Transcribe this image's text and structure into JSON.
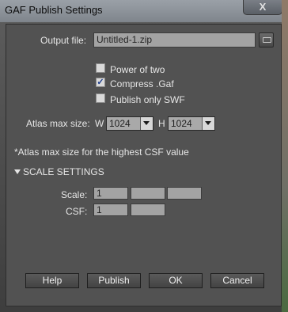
{
  "window": {
    "title": "GAF Publish Settings",
    "close_symbol": "X"
  },
  "output": {
    "label": "Output file:",
    "value": "Untitled-1.zip"
  },
  "options": {
    "power_of_two": {
      "label": "Power of two",
      "checked": false
    },
    "compress_gaf": {
      "label": "Compress .Gaf",
      "checked": true,
      "mark": "✓"
    },
    "publish_only_swf": {
      "label": "Publish only SWF",
      "checked": false
    }
  },
  "atlas": {
    "label": "Atlas max size:",
    "w_label": "W",
    "w_value": "1024",
    "h_label": "H",
    "h_value": "1024"
  },
  "note": "*Atlas max size for the highest CSF value",
  "scale_settings": {
    "header": "SCALE SETTINGS",
    "scale_label": "Scale:",
    "scale_values": [
      "1",
      "",
      ""
    ],
    "csf_label": "CSF:",
    "csf_values": [
      "1",
      ""
    ]
  },
  "buttons": {
    "help": "Help",
    "publish": "Publish",
    "ok": "OK",
    "cancel": "Cancel"
  }
}
